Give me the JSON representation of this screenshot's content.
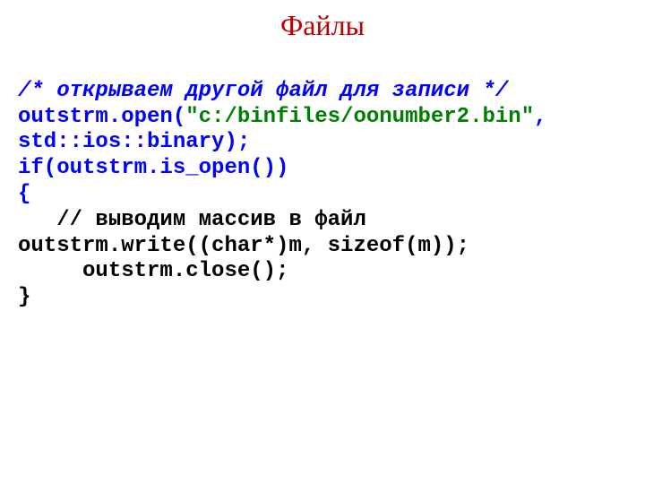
{
  "title": "Файлы",
  "code": {
    "l1": "/* открываем другой файл для записи */",
    "l2a": "outstrm.open(",
    "l2b": "\"c:/binfiles/oonumber2.bin\"",
    "l2c": ", ",
    "l3": "std::ios::binary);",
    "l4": "if(outstrm.is_open())",
    "l5": "{",
    "l6": "   // выводим массив в файл",
    "l7": "outstrm.write((char*)m, sizeof(m));",
    "l8": "     outstrm.close();",
    "l9": "}"
  }
}
